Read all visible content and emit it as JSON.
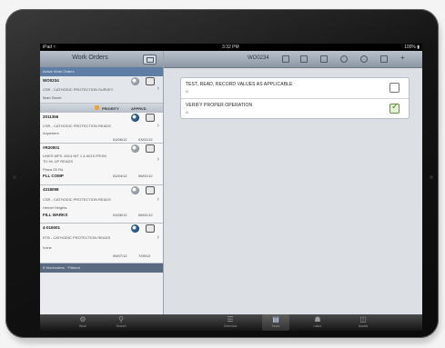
{
  "status_bar": {
    "carrier": "iPad ≈",
    "time": "3:32 PM",
    "battery": "100% ▮"
  },
  "left_pane": {
    "title": "Work Orders",
    "search_band": "Active Work Orders",
    "items": [
      {
        "num": "WO0234",
        "line2": "CSR - CATHODIC PROTECTION SURVEY",
        "line3": "Main Street",
        "badge": "PRIORITY",
        "status": "APPRVD"
      },
      {
        "num": "2011356",
        "line2": "CSR - CATHODIC PROTECTION READS",
        "line3": "Anywhere",
        "d1": "01/06/12",
        "d2": "03/01/12"
      },
      {
        "num": "#R20001",
        "line2": "LINES MFS. 6014 INT 1 & 6015 FROM",
        "line3": "TO HL UP READS",
        "line4": "Plaza Oil Rd.",
        "line5": "FLL COMP",
        "d1": "01/04/12",
        "d2": "06/01/12"
      },
      {
        "num": "4318098",
        "line2": "CSR - CATHODIC PROTECTION READS",
        "line3": "Hemet Heights",
        "line4": "FILL WARKS",
        "d1": "01/05/12",
        "d2": "06/01/12"
      },
      {
        "num": "4-016001",
        "line2": "ETB - CATHODIC PROTECTION READS",
        "line3": "Irvine",
        "d1": "09/07/12",
        "d2": "7/09/12"
      }
    ],
    "footer": "5 Workorders  ·  Filtered"
  },
  "right_pane": {
    "work_order": "WO0234",
    "tasks": [
      {
        "label": "TEST, READ, RECORD VALUES AS APPLICABLE",
        "sub": "N",
        "checked": false
      },
      {
        "label": "VERIFY PROPER OPERATION",
        "sub": "N",
        "checked": true
      }
    ]
  },
  "tab_bar": {
    "tabs": [
      {
        "label": "Work",
        "icon": "gear-icon"
      },
      {
        "label": "Search",
        "icon": "search-icon"
      },
      {
        "label": "Overview",
        "icon": "list-icon"
      },
      {
        "label": "Tasks",
        "icon": "clipboard-icon"
      },
      {
        "label": "Labor",
        "icon": "person-icon"
      },
      {
        "label": "Assets",
        "icon": "box-icon"
      }
    ],
    "active": "Tasks"
  }
}
